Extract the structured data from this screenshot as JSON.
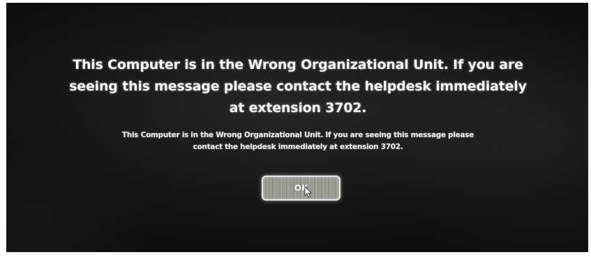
{
  "dialog": {
    "heading": "This Computer is in the Wrong Organizational Unit. If you are seeing this message please contact the helpdesk immediately at extension 3702.",
    "detail": "This Computer is in the Wrong Organizational Unit. If you are seeing this message please contact the helpdesk immediately at extension 3702.",
    "ok_label": "OK"
  },
  "colors": {
    "background": "#1c1c1c",
    "text": "#f7f7f7"
  },
  "icons": {
    "cursor": "mouse-pointer-icon"
  }
}
